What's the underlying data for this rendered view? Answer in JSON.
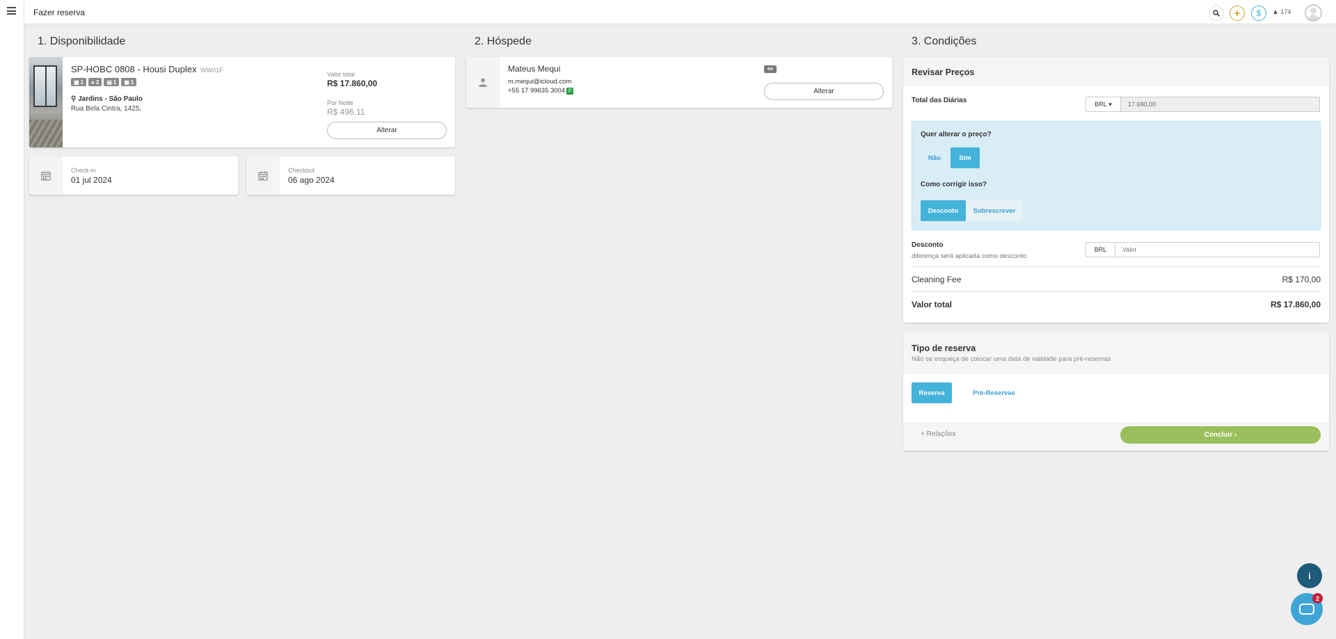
{
  "header": {
    "title": "Fazer reserva",
    "alerts_count": "174"
  },
  "columns": {
    "availability": "1. Disponibilidade",
    "guest": "2. Hóspede",
    "conditions": "3. Condições"
  },
  "property": {
    "name": "SP-HOBC 0808 - Housi Duplex",
    "code": "WW01F",
    "badges": [
      "1",
      "2",
      "1",
      "1"
    ],
    "location": "Jardins - São Paulo",
    "address": "Rua Bela Cintra, 1425,",
    "total_label": "Valor total",
    "total_value": "R$ 17.860,00",
    "night_label": "Por Noite",
    "night_value": "R$ 496,11",
    "change_label": "Alterar"
  },
  "dates": {
    "checkin_label": "Check-in",
    "checkin_value": "01 jul 2024",
    "checkout_label": "Checkout",
    "checkout_value": "06 ago 2024"
  },
  "guest": {
    "name": "Mateus Mequi",
    "email": "m.mequi@icloud.com",
    "phone": "+55 17 99635 3004",
    "language": "en",
    "change_label": "Alterar"
  },
  "conditions": {
    "title": "Revisar Preços",
    "daily_total_label": "Total das Diárias",
    "currency": "BRL",
    "daily_total_value": "17.690,00",
    "change_price_question": "Quer alterar o preço?",
    "no_label": "Não",
    "yes_label": "Sim",
    "fix_question": "Como corrigir isso?",
    "discount_option": "Desconto",
    "overwrite_option": "Sobrescrever",
    "discount_label": "Desconto",
    "discount_note": "diferença será aplicada como desconto",
    "discount_currency": "BRL",
    "discount_placeholder": "Valor",
    "cleaning_fee_label": "Cleaning Fee",
    "cleaning_fee_value": "R$ 170,00",
    "total_label": "Valor total",
    "total_value": "R$ 17.860,00"
  },
  "booking_type": {
    "title": "Tipo de reserva",
    "subtitle": "Não se esqueça de colocar uma data de validade para pré-reservas",
    "reserve_label": "Reserva",
    "pre_reserve_label": "Pré-Reservas",
    "relations_label": "Relações",
    "conclude_label": "Concluir"
  },
  "chat": {
    "unread_count": "2"
  },
  "colors": {
    "accent_blue": "#44b3da",
    "conclude_green": "#9cbf5d",
    "info_box": "#d9edf7"
  }
}
